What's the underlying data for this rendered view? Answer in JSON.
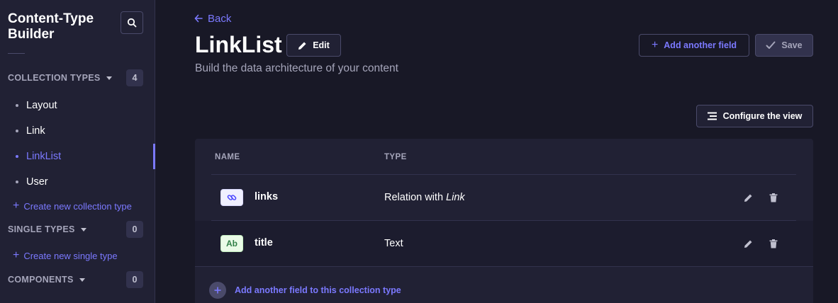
{
  "sidebar": {
    "title": "Content-Type Builder",
    "search_icon": "search-icon",
    "collection_types": {
      "label": "COLLECTION TYPES",
      "count": "4",
      "items": [
        {
          "label": "Layout",
          "active": false
        },
        {
          "label": "Link",
          "active": false
        },
        {
          "label": "LinkList",
          "active": true
        },
        {
          "label": "User",
          "active": false
        }
      ],
      "create_label": "Create new collection type"
    },
    "single_types": {
      "label": "SINGLE TYPES",
      "count": "0",
      "create_label": "Create new single type"
    },
    "components": {
      "label": "COMPONENTS",
      "count": "0"
    }
  },
  "header": {
    "back_label": "Back",
    "title": "LinkList",
    "edit_label": "Edit",
    "subtitle": "Build the data architecture of your content",
    "add_field_label": "Add another field",
    "save_label": "Save",
    "configure_label": "Configure the view"
  },
  "table": {
    "columns": [
      "NAME",
      "TYPE"
    ],
    "rows": [
      {
        "icon": "relation-icon",
        "icon_text": "",
        "name": "links",
        "type_prefix": "Relation with ",
        "type_target": "Link"
      },
      {
        "icon": "text-icon",
        "icon_text": "Ab",
        "name": "title",
        "type_prefix": "Text",
        "type_target": ""
      }
    ],
    "add_row_label": "Add another field to this collection type"
  },
  "colors": {
    "accent": "#7b79ff",
    "background": "#181826",
    "panel": "#212134"
  }
}
